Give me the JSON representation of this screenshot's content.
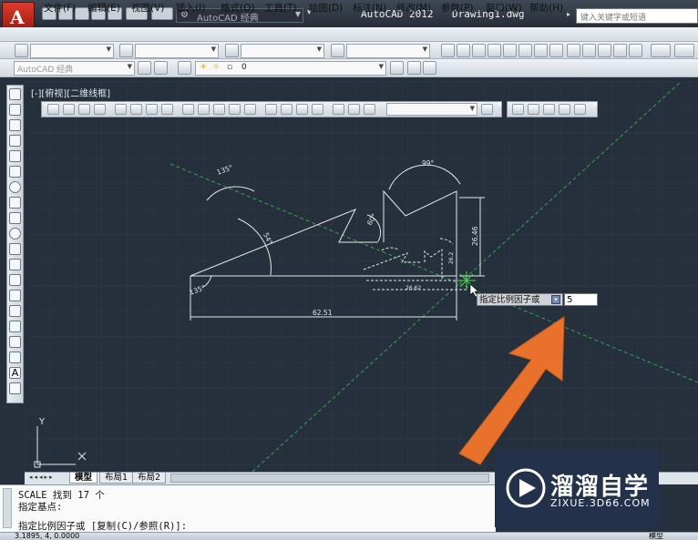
{
  "title_bar": {
    "workspace": "AutoCAD 经典",
    "app_name": "AutoCAD 2012",
    "document": "Drawing1.dwg",
    "search_placeholder": "键入关键字或短语"
  },
  "menu": [
    "文件(F)",
    "编辑(E)",
    "视图(V)",
    "插入(I)",
    "格式(O)",
    "工具(T)",
    "绘图(D)",
    "标注(N)",
    "修改(M)",
    "参数(P)",
    "窗口(W)",
    "帮助(H)"
  ],
  "toolbar2": {
    "workspace_combo": "AutoCAD 经典",
    "layer_value": "0"
  },
  "viewport_label": "[-][俯视][二维线框]",
  "drawing": {
    "dims": {
      "angle_top_left": "135°",
      "angle_right": "99°",
      "angle_diag": "54°",
      "angle_mid": "60°",
      "angle_bottom": "135°",
      "height_right": "26.46",
      "width_bottom": "62.51",
      "ghost_width": "26.62",
      "ghost_height": "26.2"
    }
  },
  "dynamic_input": {
    "prompt": "指定比例因子或",
    "value": "5"
  },
  "axis": {
    "y": "Y",
    "x": "X"
  },
  "tabs": [
    "模型",
    "布局1",
    "布局2"
  ],
  "command_lines": [
    "SCALE 找到 17 个",
    "指定基点:",
    "指定比例因子或 [复制(C)/参照(R)]:"
  ],
  "status": {
    "coord": "3.1895",
    "coord2": "4",
    "coord3": "0.0000",
    "model": "模型"
  },
  "watermark": {
    "brand": "溜溜自学",
    "url": "ZIXUE.3D66.COM"
  },
  "colors": {
    "canvas": "#26303c",
    "accent_arrow": "#e8722c",
    "app_red": "#c8281c",
    "watermark_bg": "#23324a"
  }
}
